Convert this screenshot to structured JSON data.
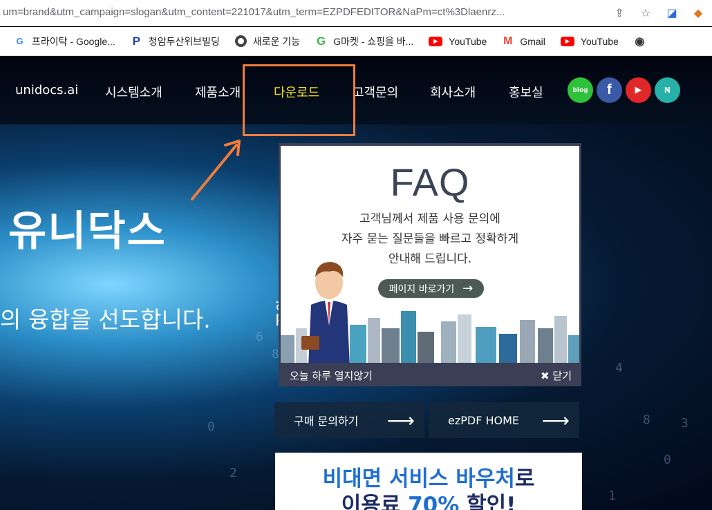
{
  "browser": {
    "url": "um=brand&utm_campaign=slogan&utm_content=221017&utm_term=EZPDFEDITOR&NaPm=ct%3Dlaenrz...",
    "bookmarks": [
      {
        "label": "프라이탁 - Google...",
        "icon": "google-icon"
      },
      {
        "label": "청암두산위브빌딩",
        "icon": "p-icon"
      },
      {
        "label": "새로운 기능",
        "icon": "chrome-icon"
      },
      {
        "label": "G마켓 - 쇼핑을 바...",
        "icon": "gmarket-icon"
      },
      {
        "label": "YouTube",
        "icon": "youtube-icon"
      },
      {
        "label": "Gmail",
        "icon": "gmail-icon"
      },
      {
        "label": "YouTube",
        "icon": "youtube-icon"
      }
    ]
  },
  "nav": {
    "items": [
      "unidocs.ai",
      "시스템소개",
      "제품소개",
      "다운로드",
      "고객문의",
      "회사소개",
      "홍보실"
    ],
    "social": [
      "blog",
      "f",
      "▶",
      "N"
    ]
  },
  "hero": {
    "title": "유니닥스",
    "subtitle": "의 융합을 선도합니다."
  },
  "popup": {
    "title": "FAQ",
    "desc_lines": [
      "고객님께서 제품 사용 문의에",
      "자주 묻는 질문들을 빠르고 정확하게",
      "안내해 드립니다."
    ],
    "button": "페이지 바로가기",
    "no_show": "오늘 하루 열지않기",
    "close": "닫기"
  },
  "cta": {
    "buy": "구매 문의하기",
    "home": "ezPDF HOME"
  },
  "banner": {
    "line1_a": "비대면 서비스 바우처",
    "line1_b": "로",
    "line2_a": "이용료 ",
    "line2_b": "70%",
    "line2_c": " 할인!"
  },
  "colors": {
    "accent": "#f4e11e",
    "highlight": "#f07d3a",
    "banner_text": "#1d2a63"
  }
}
